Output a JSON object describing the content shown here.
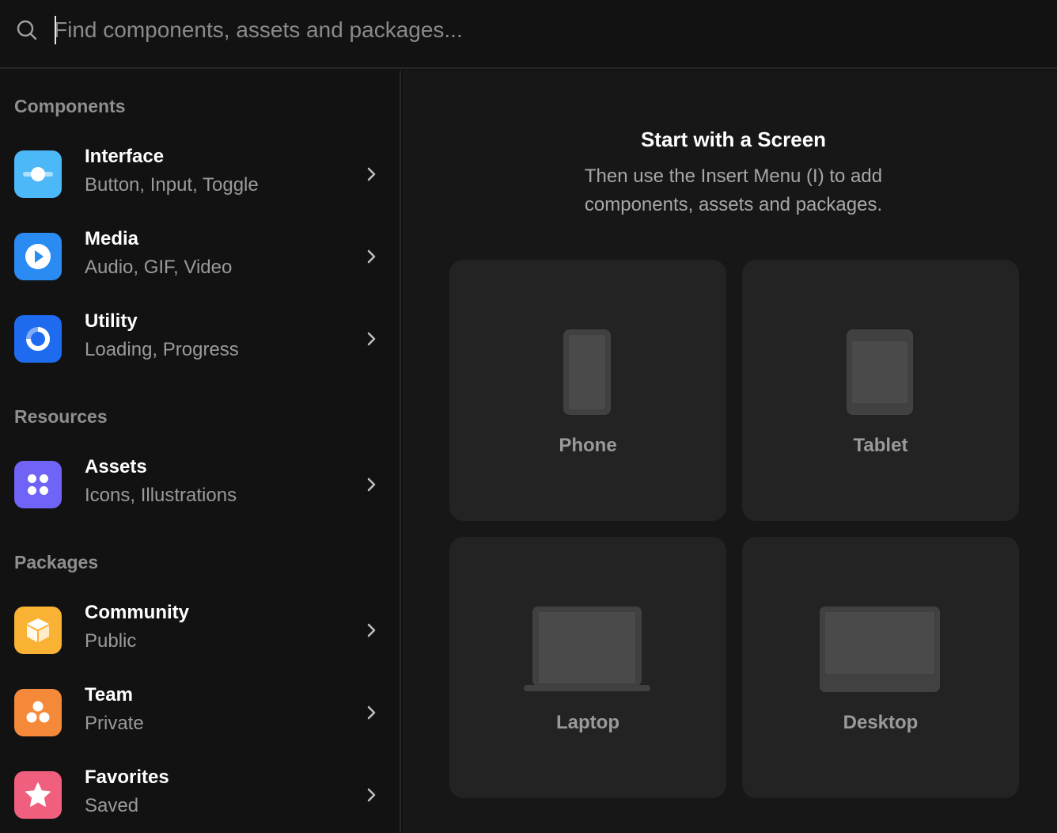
{
  "search": {
    "placeholder": "Find components, assets and packages..."
  },
  "sidebar": {
    "sections": [
      {
        "title": "Components"
      },
      {
        "title": "Resources"
      },
      {
        "title": "Packages"
      }
    ],
    "items": [
      {
        "name": "Interface",
        "sub": "Button, Input, Toggle",
        "icon": "toggle-icon",
        "color": "#4DB8F8"
      },
      {
        "name": "Media",
        "sub": "Audio, GIF, Video",
        "icon": "play-icon",
        "color": "#2A8BF2"
      },
      {
        "name": "Utility",
        "sub": "Loading, Progress",
        "icon": "loading-icon",
        "color": "#1F6BF0"
      },
      {
        "name": "Assets",
        "sub": "Icons, Illustrations",
        "icon": "grid-dots-icon",
        "color": "#6F64F6"
      },
      {
        "name": "Community",
        "sub": "Public",
        "icon": "package-box-icon",
        "color": "#F9B233"
      },
      {
        "name": "Team",
        "sub": "Private",
        "icon": "team-icon",
        "color": "#F5893A"
      },
      {
        "name": "Favorites",
        "sub": "Saved",
        "icon": "star-icon",
        "color": "#F0607E"
      }
    ]
  },
  "main": {
    "title": "Start with a Screen",
    "subtitle": "Then use the Insert Menu (I) to add components, assets and packages.",
    "devices": [
      {
        "label": "Phone",
        "icon": "phone-icon"
      },
      {
        "label": "Tablet",
        "icon": "tablet-icon"
      },
      {
        "label": "Laptop",
        "icon": "laptop-icon"
      },
      {
        "label": "Desktop",
        "icon": "desktop-icon"
      }
    ]
  }
}
